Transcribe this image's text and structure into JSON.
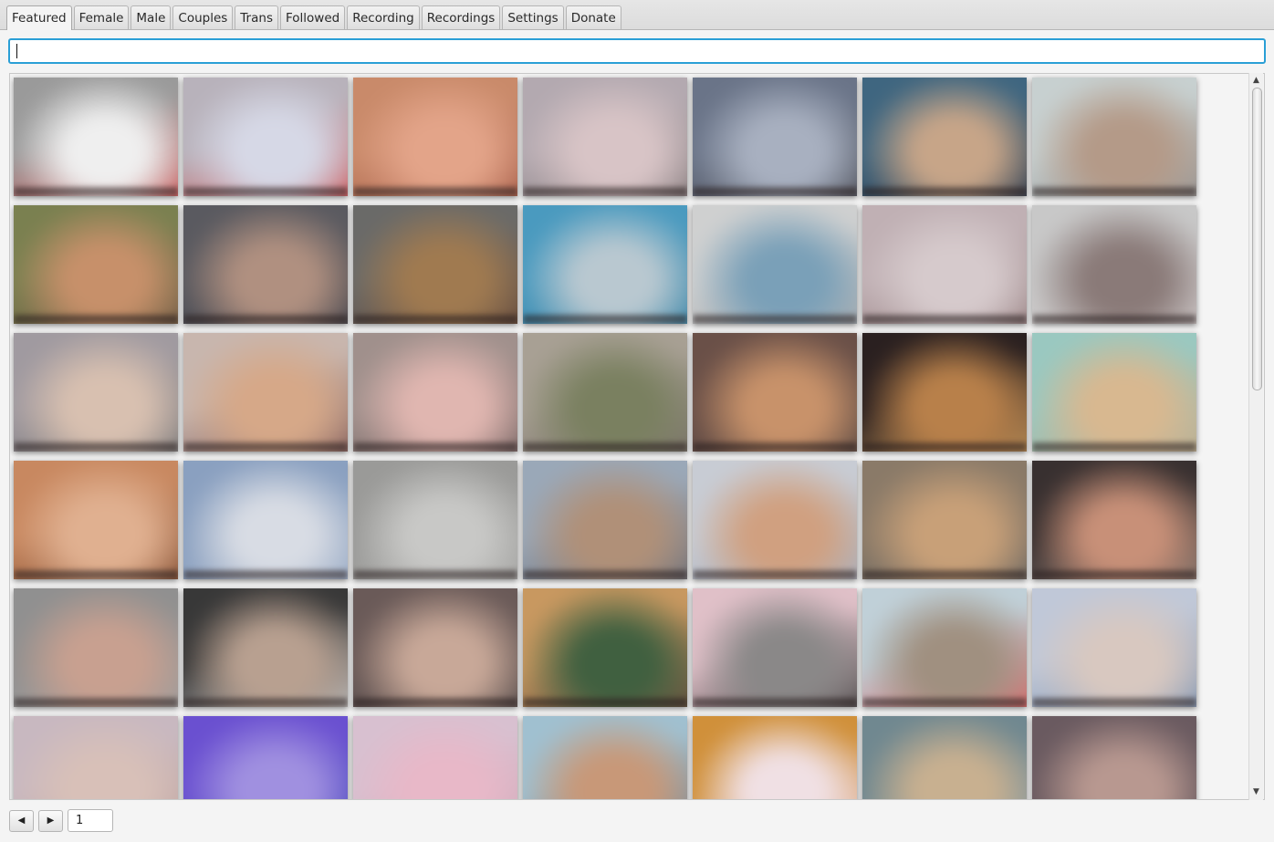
{
  "tabs": [
    {
      "label": "Featured",
      "selected": true
    },
    {
      "label": "Female",
      "selected": false
    },
    {
      "label": "Male",
      "selected": false
    },
    {
      "label": "Couples",
      "selected": false
    },
    {
      "label": "Trans",
      "selected": false
    },
    {
      "label": "Followed",
      "selected": false
    },
    {
      "label": "Recording",
      "selected": false
    },
    {
      "label": "Recordings",
      "selected": false
    },
    {
      "label": "Settings",
      "selected": false
    },
    {
      "label": "Donate",
      "selected": false
    }
  ],
  "search": {
    "value": "",
    "placeholder": ""
  },
  "thumbnails": [
    [
      "#9a9a9a",
      "#efefef",
      "#d24040"
    ],
    [
      "#b8b2bb",
      "#d6d8e6",
      "#d24040"
    ],
    [
      "#c98a6a",
      "#e3a489",
      "#9c5040"
    ],
    [
      "#b3a9b0",
      "#d8c4c6",
      "#7a7070"
    ],
    [
      "#6a7488",
      "#a8b0c0",
      "#4a4a50"
    ],
    [
      "#3f6680",
      "#c7a588",
      "#2a3040"
    ],
    [
      "#c7d0d0",
      "#b49a88",
      "#8a8888"
    ],
    [
      "#7a8050",
      "#c7906a",
      "#6a5040"
    ],
    [
      "#5a5a60",
      "#b09080",
      "#404048"
    ],
    [
      "#6a6a68",
      "#a07a50",
      "#604030"
    ],
    [
      "#4a9abf",
      "#b9c8d0",
      "#3a80a0"
    ],
    [
      "#cfd0d0",
      "#7aa0b8",
      "#a0a4a8"
    ],
    [
      "#c0b0b4",
      "#d6cacc",
      "#907878"
    ],
    [
      "#c8c8c8",
      "#8a7a78",
      "#d0c8c8"
    ],
    [
      "#a09aa0",
      "#d8c0b0",
      "#707070"
    ],
    [
      "#c8b6ae",
      "#d6a888",
      "#704848"
    ],
    [
      "#a0908c",
      "#e0b6b0",
      "#6a5858"
    ],
    [
      "#a8a094",
      "#7a8060",
      "#706860"
    ],
    [
      "#6a5048",
      "#c8926a",
      "#5a4a44"
    ],
    [
      "#2a2020",
      "#b8804a",
      "#d0a060"
    ],
    [
      "#9ac8c0",
      "#d8b890",
      "#c0a888"
    ],
    [
      "#c88860",
      "#e0b090",
      "#704028"
    ],
    [
      "#8aa0c0",
      "#d8dce4",
      "#a0b0c8"
    ],
    [
      "#9a9a98",
      "#c8c8c6",
      "#a8a8a6"
    ],
    [
      "#9aa8b8",
      "#b09078",
      "#606068"
    ],
    [
      "#c8ccd4",
      "#d0a080",
      "#a0a8b8"
    ],
    [
      "#8a7a68",
      "#c8a078",
      "#606060"
    ],
    [
      "#383030",
      "#c89078",
      "#908078"
    ],
    [
      "#909090",
      "#c8a090",
      "#a0a0a0"
    ],
    [
      "#383838",
      "#b8a090",
      "#d8d8d8"
    ],
    [
      "#6a5a58",
      "#c8a898",
      "#504848"
    ],
    [
      "#c89860",
      "#406040",
      "#504038"
    ],
    [
      "#e0c0c8",
      "#8a8888",
      "#303030"
    ],
    [
      "#c0d0d8",
      "#a09080",
      "#e05050"
    ],
    [
      "#c0c8d8",
      "#d8c8c0",
      "#7088a8"
    ],
    [
      "#c8b8c0",
      "#d8c0b8",
      "#b89890"
    ],
    [
      "#6a50d0",
      "#a090e0",
      "#3040b0"
    ],
    [
      "#d8c0d0",
      "#e8b8c8",
      "#c8a0b0"
    ],
    [
      "#a0c0d0",
      "#c89878",
      "#607080"
    ],
    [
      "#d0903a",
      "#f0e0e4",
      "#e8c8d0"
    ],
    [
      "#708890",
      "#c8b090",
      "#90a0a8"
    ],
    [
      "#6a5a60",
      "#b89890",
      "#504850"
    ]
  ],
  "pager": {
    "prev_icon": "triangle-left-icon",
    "next_icon": "triangle-right-icon",
    "page": "1"
  },
  "scrollbar": {
    "up_icon": "chevron-up-icon",
    "down_icon": "chevron-down-icon",
    "position": 0.0,
    "visible_fraction": 0.42
  }
}
